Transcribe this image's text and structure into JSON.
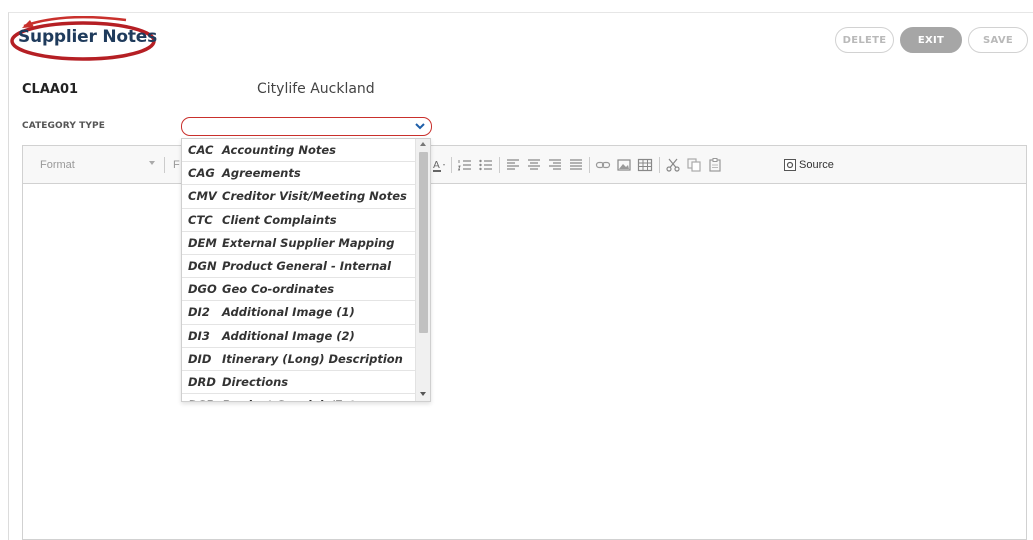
{
  "header": {
    "title": "Supplier Notes",
    "buttons": {
      "delete": "DELETE",
      "exit": "EXIT",
      "save": "SAVE"
    }
  },
  "supplier": {
    "code": "CLAA01",
    "name": "Citylife Auckland"
  },
  "category": {
    "label": "CATEGORY TYPE",
    "selected": ""
  },
  "editor": {
    "format_label": "Format",
    "font_label": "F",
    "source_label": "Source"
  },
  "category_options": [
    {
      "code": "CAC",
      "description": "Accounting Notes"
    },
    {
      "code": "CAG",
      "description": "Agreements"
    },
    {
      "code": "CMV",
      "description": "Creditor Visit/Meeting Notes"
    },
    {
      "code": "CTC",
      "description": "Client Complaints"
    },
    {
      "code": "DEM",
      "description": "External Supplier Mapping"
    },
    {
      "code": "DGN",
      "description": "Product General - Internal"
    },
    {
      "code": "DGO",
      "description": "Geo Co-ordinates"
    },
    {
      "code": "DI2",
      "description": "Additional Image (1)"
    },
    {
      "code": "DI3",
      "description": "Additional Image (2)"
    },
    {
      "code": "DID",
      "description": "Itinerary (Long) Description"
    },
    {
      "code": "DRD",
      "description": "Directions"
    },
    {
      "code": "DSP",
      "description": "Product Specials/Extras"
    }
  ],
  "colors": {
    "accent_red": "#c9302c",
    "title_navy": "#1f3b5c",
    "exit_gray": "#a6a6a6"
  },
  "icons": [
    "font-color-icon",
    "numbered-list-icon",
    "bulleted-list-icon",
    "align-left-icon",
    "align-center-icon",
    "align-right-icon",
    "justify-icon",
    "link-icon",
    "image-icon",
    "table-icon",
    "cut-icon",
    "copy-icon",
    "paste-icon",
    "source-icon",
    "chevron-down-icon"
  ]
}
